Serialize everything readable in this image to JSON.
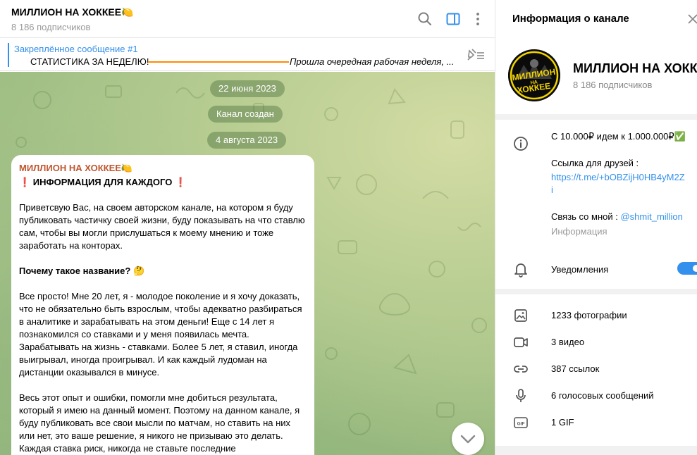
{
  "chat": {
    "title": "МИЛЛИОН НА ХОККЕЕ🍋",
    "subscribers": "8 186 подписчиков",
    "pinned": {
      "label": "Закреплённое сообщение #1",
      "text": "СТАТИСТИКА ЗА НЕДЕЛЮ!",
      "preview": "Прошла очередная рабочая неделя, ..."
    },
    "dates": [
      "22 июня 2023",
      "Канал создан",
      "4 августа 2023"
    ],
    "message": {
      "sender": "МИЛЛИОН НА ХОККЕЕ🍋",
      "heading_mark_left": "❗",
      "heading": " ИНФОРМАЦИЯ ДЛЯ КАЖДОГО ",
      "heading_mark_right": "❗",
      "p1": "Приветсвую Вас, на своем авторском канале, на котором я буду публиковать частичку своей жизни, буду показывать на что ставлю сам, чтобы вы могли прислушаться к моему мнению и тоже заработать на конторах.",
      "p2": "Почему такое название? 🤔",
      "p3": "Все просто! Мне 20 лет, я - молодое поколение и я хочу доказать, что не обязательно быть взрослым, чтобы адекватно разбираться в аналитике и зарабатывать на этом деньги! Еще с 14 лет я познакомился со ставками и у меня появилась мечта. Зарабатывать на жизнь - ставками. Более 5 лет, я ставил, иногда выигрывал, иногда проигрывал. И как каждый лудоман на дистанции оказывался в минусе.",
      "p4": "Весь этот опыт и ошибки, помогли мне добиться результата, который я имею на данный момент. Поэтому на данном канале, я буду публиковать все свои мысли по матчам, но ставить на них или нет, это ваше решение, я никого не призываю это делать. Каждая ставка риск, никогда не ставьте последние"
    }
  },
  "panel": {
    "title": "Информация о канале",
    "name": "МИЛЛИОН НА ХОККЕ...",
    "subscribers": "8 186 подписчиков",
    "avatar_text_top": "МИЛЛИОН",
    "avatar_text_mid": "НА",
    "avatar_text_bottom": "ХОККЕЕ",
    "info": {
      "description": "С 10.000₽ идем к 1.000.000₽✅",
      "friends_label": "Ссылка для друзей :",
      "friends_link_1": "https://t.me/+bOBZijH0HB4yM2Z",
      "friends_link_2": "i",
      "contact_label": "Связь со мной : ",
      "contact_handle": "@shmit_million",
      "info_caption": "Информация",
      "notifications": "Уведомления",
      "notifications_on": true
    },
    "media": [
      {
        "icon": "photo-icon",
        "label": "1233 фотографии"
      },
      {
        "icon": "video-icon",
        "label": "3 видео"
      },
      {
        "icon": "link-icon",
        "label": "387 ссылок"
      },
      {
        "icon": "microphone-icon",
        "label": "6 голосовых сообщений"
      },
      {
        "icon": "gif-icon",
        "label": "1 GIF"
      }
    ]
  },
  "colors": {
    "accent": "#3390ec",
    "sender": "#c0562f",
    "pinned_line": "#ff8a00",
    "chat_background": "#a4c389"
  }
}
